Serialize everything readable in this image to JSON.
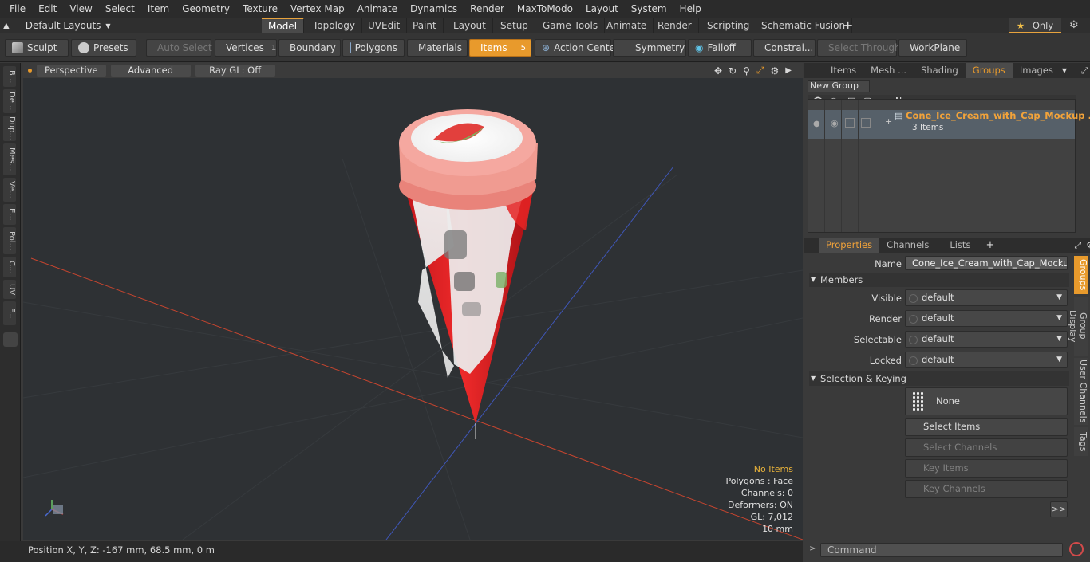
{
  "menu": [
    "File",
    "Edit",
    "View",
    "Select",
    "Item",
    "Geometry",
    "Texture",
    "Vertex Map",
    "Animate",
    "Dynamics",
    "Render",
    "MaxToModo",
    "Layout",
    "System",
    "Help"
  ],
  "layout_selector": "Default Layouts",
  "tabs": [
    "Model",
    "Topology",
    "UVEdit",
    "Paint",
    "Layout",
    "Setup",
    "Game Tools",
    "Animate",
    "Render",
    "Scripting",
    "Schematic Fusion"
  ],
  "only_label": "Only",
  "toolbar": {
    "sculpt": "Sculpt",
    "presets": "Presets",
    "auto_select": "Auto Select",
    "vertices": "Vertices",
    "vertices_count": "1",
    "boundary": "Boundary",
    "polygons": "Polygons",
    "materials": "Materials",
    "items": "Items",
    "items_count": "5",
    "action_center": "Action Center",
    "symmetry": "Symmetry",
    "falloff": "Falloff",
    "constrain": "Constrai...",
    "select_through": "Select Through",
    "workplane": "WorkPlane"
  },
  "left_tabs": [
    "B...",
    "De...",
    "Dup...",
    "Mes...",
    "Ve...",
    "E...",
    "Pol...",
    "C...",
    "UV",
    "F..."
  ],
  "viewport": {
    "view": "Perspective",
    "shading": "Advanced",
    "raygl": "Ray GL: Off",
    "stats": {
      "items": "No Items",
      "polygons": "Polygons : Face",
      "channels": "Channels: 0",
      "deformers": "Deformers: ON",
      "gl": "GL: 7,012",
      "scale": "10 mm"
    }
  },
  "status": "Position X, Y, Z:   -167 mm, 68.5 mm, 0 m",
  "groups_panel": {
    "tabs": [
      "Items",
      "Mesh ...",
      "Shading",
      "Groups",
      "Images"
    ],
    "new_group": "New Group",
    "name_header": "Name",
    "group_name": "Cone_Ice_Cream_with_Cap_Mockup ...",
    "group_items": "3 Items"
  },
  "properties": {
    "tabs": [
      "Properties",
      "Channels",
      "Lists"
    ],
    "name_label": "Name",
    "name_value": "Cone_Ice_Cream_with_Cap_Mockup_SI",
    "members": "Members",
    "rows": [
      {
        "label": "Visible",
        "value": "default"
      },
      {
        "label": "Render",
        "value": "default"
      },
      {
        "label": "Selectable",
        "value": "default"
      },
      {
        "label": "Locked",
        "value": "default"
      }
    ],
    "selection_keying": "Selection & Keying",
    "none": "None",
    "select_items": "Select Items",
    "select_channels": "Select Channels",
    "key_items": "Key Items",
    "key_channels": "Key Channels",
    "more": ">>",
    "side_tabs": [
      "Groups",
      "Group Display",
      "User Channels",
      "Tags"
    ]
  },
  "command_placeholder": "Command",
  "colors": {
    "accent": "#e89a2c",
    "group_name": "#f2a33a"
  }
}
